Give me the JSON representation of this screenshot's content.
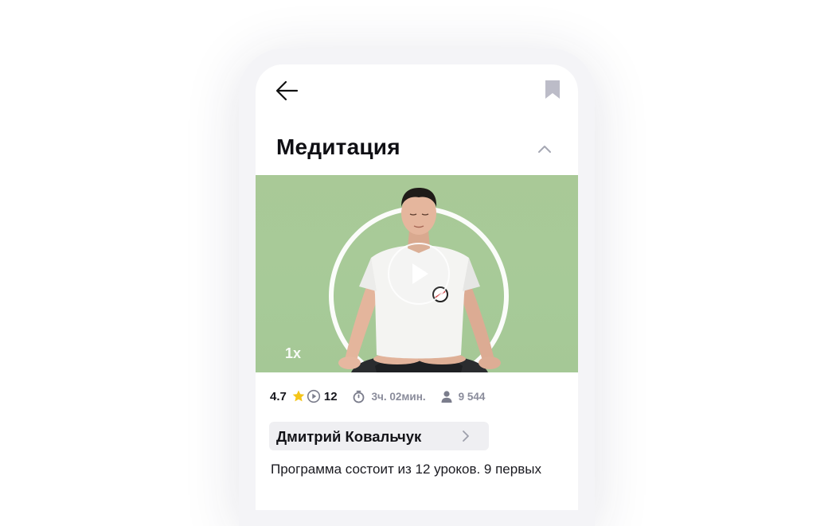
{
  "header": {
    "back_icon": "arrow-left-icon",
    "bookmark_icon": "bookmark-icon"
  },
  "course": {
    "title": "Медитация",
    "collapse_icon": "chevron-up-icon"
  },
  "video": {
    "speed": "1x",
    "play_icon": "play-icon",
    "background_color": "#a8c998"
  },
  "stats": {
    "rating": "4.7",
    "rating_icon": "star-icon",
    "lessons_icon": "play-circle-icon",
    "lessons": "12",
    "duration_icon": "stopwatch-icon",
    "duration": "3ч. 02мин.",
    "students_icon": "user-icon",
    "students": "9 544"
  },
  "author": {
    "name": "Дмитрий Ковальчук",
    "chevron_icon": "chevron-right-icon"
  },
  "description": "Программа состоит из 12 уроков. 9 первых",
  "colors": {
    "accent_star": "#f5c518",
    "muted": "#8a8c9b",
    "chip_bg": "#efeff2"
  }
}
